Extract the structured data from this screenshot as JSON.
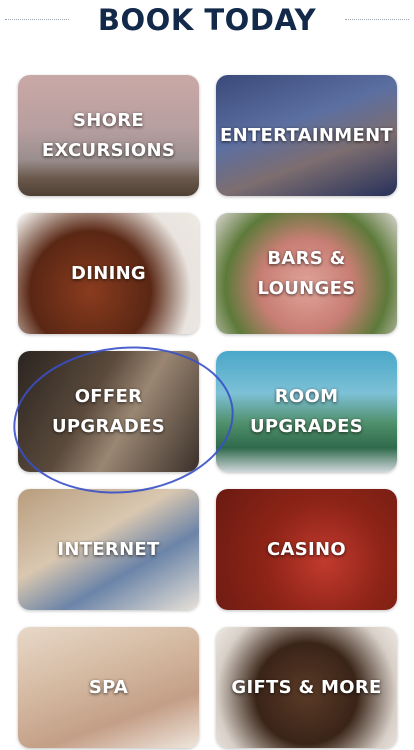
{
  "header": {
    "title": "BOOK TODAY"
  },
  "tiles": [
    {
      "label": "SHORE\nEXCURSIONS"
    },
    {
      "label": "ENTERTAINMENT"
    },
    {
      "label": "DINING"
    },
    {
      "label": "BARS &\nLOUNGES"
    },
    {
      "label": "OFFER\nUPGRADES"
    },
    {
      "label": "ROOM\nUPGRADES"
    },
    {
      "label": "INTERNET"
    },
    {
      "label": "CASINO"
    },
    {
      "label": "SPA"
    },
    {
      "label": "GIFTS & MORE"
    }
  ],
  "colors": {
    "title": "#13294a",
    "annotation_circle": "#3850c8"
  }
}
